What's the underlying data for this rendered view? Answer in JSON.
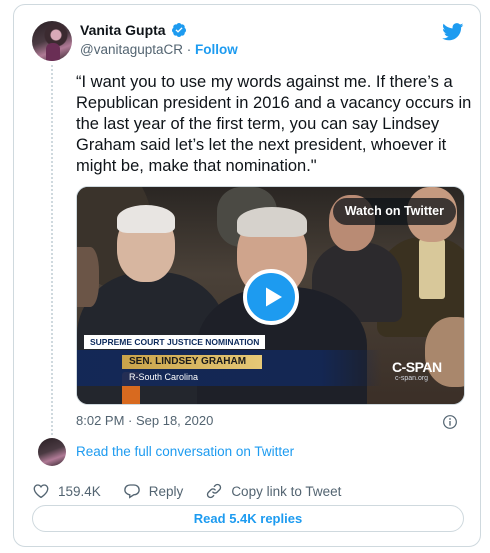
{
  "author": {
    "display_name": "Vanita Gupta",
    "handle": "@vanitaguptaCR",
    "separator": "·",
    "follow_label": "Follow"
  },
  "tweet": {
    "text": "“I want you to use my words against me. If there’s a Republican president in 2016 and a vacancy occurs in the last year of the first term, you can say Lindsey Graham said let’s let the next president, whoever it might be, make that nomination.\"",
    "timestamp": "8:02 PM · Sep 18, 2020"
  },
  "media": {
    "watch_label": "Watch on Twitter",
    "banner_top": "SUPREME COURT JUSTICE NOMINATION",
    "banner_name": "SEN. LINDSEY GRAHAM",
    "banner_sub": "R-South Carolina",
    "network": "C-SPAN",
    "network_url": "c-span.org"
  },
  "conversation": {
    "label": "Read the full conversation on Twitter"
  },
  "actions": {
    "likes": "159.4K",
    "reply_label": "Reply",
    "copy_label": "Copy link to Tweet"
  },
  "replies_button": "Read 5.4K replies",
  "colors": {
    "accent": "#1d9bf0",
    "muted": "#536471",
    "like_red": "#f91880"
  }
}
